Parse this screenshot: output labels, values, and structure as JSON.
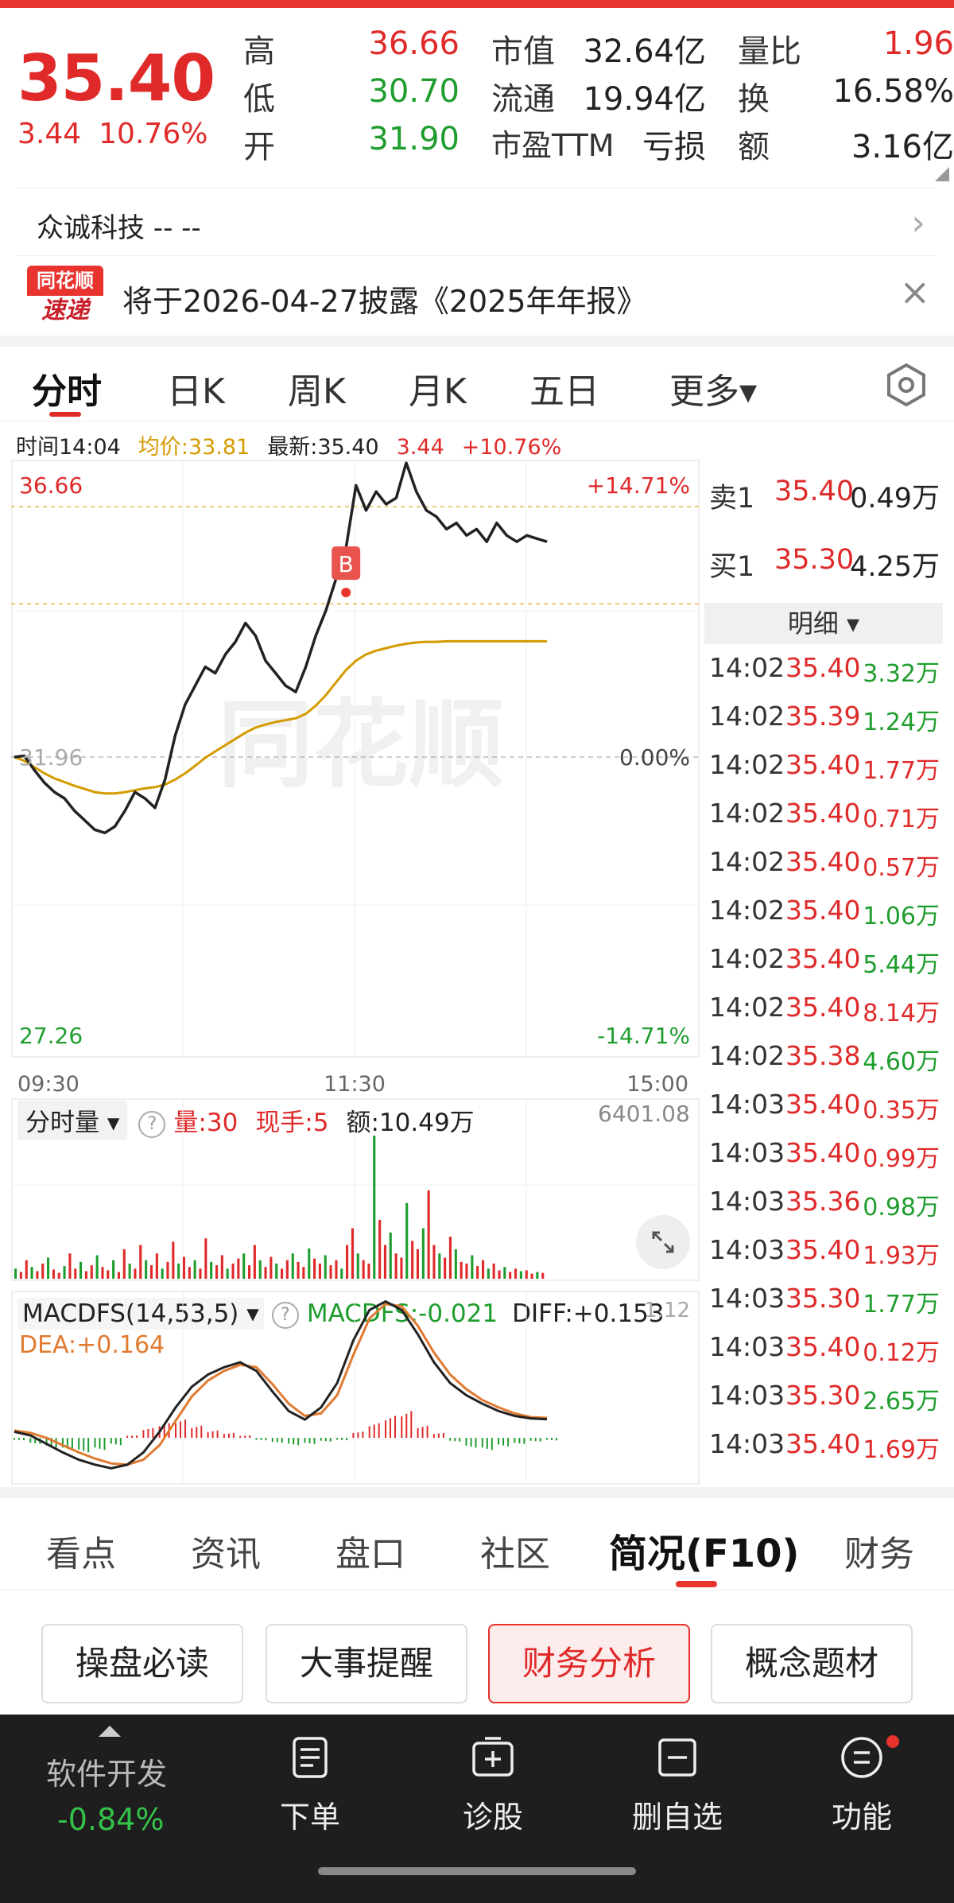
{
  "header": {
    "price": "35.40",
    "change": "3.44",
    "change_pct": "10.76%",
    "rows": [
      {
        "l1": "高",
        "v1": "36.66",
        "c1": "red",
        "l2": "市值",
        "v2": "32.64亿",
        "c2": "dark",
        "l3": "量比",
        "v3": "1.96",
        "c3": "red"
      },
      {
        "l1": "低",
        "v1": "30.70",
        "c1": "green",
        "l2": "流通",
        "v2": "19.94亿",
        "c2": "dark",
        "l3": "换",
        "v3": "16.58%",
        "c3": "dark"
      },
      {
        "l1": "开",
        "v1": "31.90",
        "c1": "green",
        "l2": "市盈TTM",
        "v2": "亏损",
        "c2": "dark",
        "l3": "额",
        "v3": "3.16亿",
        "c3": "dark"
      }
    ]
  },
  "company": {
    "name": "众诚科技  --  --"
  },
  "notice": {
    "logo_top": "同花顺",
    "logo_bottom": "速递",
    "text": "将于2026-04-27披露《2025年年报》",
    "close": "×"
  },
  "tabs": [
    {
      "label": "分时",
      "active": true
    },
    {
      "label": "日K"
    },
    {
      "label": "周K"
    },
    {
      "label": "月K"
    },
    {
      "label": "五日"
    },
    {
      "label": "更多▾"
    }
  ],
  "info_line": {
    "time": "时间14:04",
    "avg": "均价:33.81",
    "latest": "最新:35.40",
    "change": "3.44",
    "change_pct": "+10.76%"
  },
  "chart_data": {
    "type": "line",
    "title": "",
    "price_high_label": "36.66",
    "price_low_label": "27.26",
    "prev_close_label": "31.96",
    "pct_high_label": "+14.71%",
    "pct_zero_label": "0.00%",
    "pct_low_label": "-14.71%",
    "x_ticks": [
      "09:30",
      "11:30",
      "15:00"
    ],
    "ylim": [
      27.26,
      36.66
    ],
    "buy_marker": "B",
    "watermark": "同花顺",
    "series": [
      {
        "name": "price",
        "color": "#222222",
        "values": [
          31.96,
          31.98,
          31.75,
          31.55,
          31.4,
          31.3,
          31.1,
          30.95,
          30.8,
          30.75,
          30.85,
          31.1,
          31.4,
          31.3,
          31.15,
          31.6,
          32.3,
          32.8,
          33.1,
          33.4,
          33.3,
          33.6,
          33.8,
          34.1,
          33.9,
          33.5,
          33.3,
          33.1,
          33.0,
          33.4,
          33.9,
          34.3,
          34.8,
          35.3,
          36.3,
          35.9,
          36.2,
          36.0,
          36.1,
          36.66,
          36.2,
          35.9,
          35.8,
          35.6,
          35.7,
          35.5,
          35.6,
          35.4,
          35.7,
          35.5,
          35.4,
          35.5,
          35.45,
          35.4
        ]
      },
      {
        "name": "avg",
        "color": "#d49a00",
        "values": [
          31.96,
          31.9,
          31.8,
          31.7,
          31.62,
          31.56,
          31.5,
          31.45,
          31.4,
          31.38,
          31.38,
          31.4,
          31.43,
          31.46,
          31.48,
          31.52,
          31.6,
          31.7,
          31.82,
          31.95,
          32.05,
          32.15,
          32.25,
          32.35,
          32.43,
          32.48,
          32.52,
          32.55,
          32.58,
          32.65,
          32.78,
          32.95,
          33.15,
          33.35,
          33.5,
          33.6,
          33.66,
          33.7,
          33.74,
          33.77,
          33.79,
          33.8,
          33.8,
          33.81,
          33.81,
          33.81,
          33.81,
          33.81,
          33.81,
          33.81,
          33.81,
          33.81,
          33.81,
          33.81
        ]
      }
    ]
  },
  "volume": {
    "selector": "分时量",
    "help": "?",
    "qty": "量:30",
    "now": "现手:5",
    "amount": "额:10.49万",
    "max": "6401.08",
    "values": [
      12,
      8,
      22,
      14,
      9,
      18,
      25,
      11,
      7,
      15,
      30,
      12,
      20,
      9,
      16,
      28,
      14,
      10,
      22,
      8,
      35,
      18,
      12,
      40,
      22,
      16,
      30,
      12,
      20,
      44,
      18,
      26,
      14,
      22,
      12,
      48,
      20,
      16,
      28,
      12,
      18,
      24,
      30,
      16,
      40,
      22,
      14,
      26,
      18,
      12,
      22,
      30,
      20,
      14,
      36,
      24,
      18,
      28,
      16,
      22,
      12,
      40,
      60,
      30,
      22,
      18,
      170,
      70,
      40,
      55,
      30,
      25,
      90,
      45,
      35,
      60,
      105,
      40,
      30,
      25,
      50,
      35,
      20,
      18,
      28,
      15,
      22,
      12,
      18,
      10,
      14,
      8,
      12,
      9,
      10,
      6,
      8,
      7
    ]
  },
  "macd": {
    "selector": "MACDFS(14,53,5)",
    "help": "?",
    "macdfs": "MACDFS:-0.021",
    "diff": "DIFF:+0.153",
    "dea": "DEA:+0.164",
    "scale_label": "1.12",
    "diff_values": [
      0.05,
      0.02,
      -0.05,
      -0.12,
      -0.18,
      -0.22,
      -0.25,
      -0.22,
      -0.12,
      0.05,
      0.25,
      0.42,
      0.52,
      0.58,
      0.62,
      0.55,
      0.38,
      0.22,
      0.15,
      0.25,
      0.45,
      0.8,
      1.05,
      1.12,
      1.05,
      0.85,
      0.62,
      0.45,
      0.35,
      0.28,
      0.22,
      0.18,
      0.16,
      0.153
    ],
    "dea_values": [
      0.06,
      0.04,
      0.0,
      -0.06,
      -0.12,
      -0.17,
      -0.21,
      -0.22,
      -0.18,
      -0.06,
      0.14,
      0.34,
      0.47,
      0.55,
      0.6,
      0.58,
      0.44,
      0.28,
      0.18,
      0.2,
      0.35,
      0.68,
      0.98,
      1.1,
      1.08,
      0.92,
      0.7,
      0.52,
      0.4,
      0.31,
      0.25,
      0.2,
      0.17,
      0.164
    ],
    "hist_values": [
      -0.02,
      -0.05,
      -0.08,
      -0.1,
      -0.12,
      -0.1,
      -0.06,
      0.02,
      0.08,
      0.12,
      0.15,
      0.1,
      0.06,
      0.04,
      0.02,
      -0.02,
      -0.04,
      -0.06,
      -0.05,
      -0.03,
      -0.02,
      0.05,
      0.12,
      0.18,
      0.22,
      0.1,
      0.04,
      -0.03,
      -0.08,
      -0.1,
      -0.07,
      -0.05,
      -0.03,
      -0.021
    ]
  },
  "order_book": {
    "sell": {
      "label": "卖1",
      "price": "35.40",
      "volume": "0.49万"
    },
    "buy": {
      "label": "买1",
      "price": "35.30",
      "volume": "4.25万"
    },
    "detail": "明细 ▾"
  },
  "trades": [
    {
      "time": "14:02",
      "price": "35.40",
      "volume": "3.32万",
      "side": "buy"
    },
    {
      "time": "14:02",
      "price": "35.39",
      "volume": "1.24万",
      "side": "buy"
    },
    {
      "time": "14:02",
      "price": "35.40",
      "volume": "1.77万",
      "side": "sell"
    },
    {
      "time": "14:02",
      "price": "35.40",
      "volume": "0.71万",
      "side": "sell"
    },
    {
      "time": "14:02",
      "price": "35.40",
      "volume": "0.57万",
      "side": "sell"
    },
    {
      "time": "14:02",
      "price": "35.40",
      "volume": "1.06万",
      "side": "buy"
    },
    {
      "time": "14:02",
      "price": "35.40",
      "volume": "5.44万",
      "side": "buy"
    },
    {
      "time": "14:02",
      "price": "35.40",
      "volume": "8.14万",
      "side": "sell"
    },
    {
      "time": "14:02",
      "price": "35.38",
      "volume": "4.60万",
      "side": "buy"
    },
    {
      "time": "14:03",
      "price": "35.40",
      "volume": "0.35万",
      "side": "sell"
    },
    {
      "time": "14:03",
      "price": "35.40",
      "volume": "0.99万",
      "side": "sell"
    },
    {
      "time": "14:03",
      "price": "35.36",
      "volume": "0.98万",
      "side": "buy"
    },
    {
      "time": "14:03",
      "price": "35.40",
      "volume": "1.93万",
      "side": "sell"
    },
    {
      "time": "14:03",
      "price": "35.30",
      "volume": "1.77万",
      "side": "buy"
    },
    {
      "time": "14:03",
      "price": "35.40",
      "volume": "0.12万",
      "side": "sell"
    },
    {
      "time": "14:03",
      "price": "35.30",
      "volume": "2.65万",
      "side": "buy"
    },
    {
      "time": "14:03",
      "price": "35.40",
      "volume": "1.69万",
      "side": "sell"
    }
  ],
  "bottom_tabs": [
    {
      "label": "看点"
    },
    {
      "label": "资讯"
    },
    {
      "label": "盘口"
    },
    {
      "label": "社区"
    },
    {
      "label": "简况(F10)",
      "active": true
    },
    {
      "label": "财务"
    }
  ],
  "pills": [
    {
      "label": "操盘必读"
    },
    {
      "label": "大事提醒"
    },
    {
      "label": "财务分析",
      "active": true
    },
    {
      "label": "概念题材"
    }
  ],
  "bottom_bar": {
    "sector": "软件开发",
    "sector_change": "-0.84%",
    "items": [
      {
        "label": "下单",
        "icon": "document-icon"
      },
      {
        "label": "诊股",
        "icon": "plus-box-icon"
      },
      {
        "label": "删自选",
        "icon": "minus-box-icon"
      },
      {
        "label": "功能",
        "icon": "menu-circle-icon"
      }
    ]
  },
  "colors": {
    "up": "#e02a2a",
    "down": "#1f9d2e",
    "accent": "#e8332e",
    "avg": "#d49a00",
    "dea": "#e07a30"
  }
}
